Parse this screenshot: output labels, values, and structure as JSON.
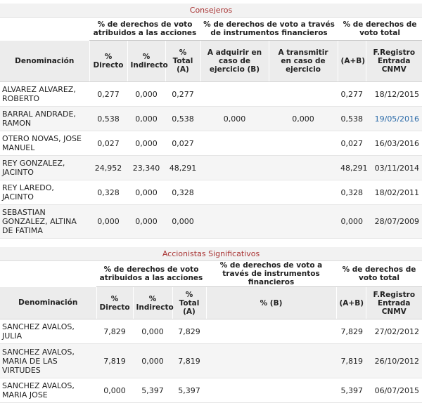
{
  "consejeros": {
    "title": "Consejeros",
    "group_headers": {
      "acciones": "% de derechos de voto atribuidos a las acciones",
      "instrumentos": "% de derechos de voto a través de instrumentos financieros",
      "total": "% de derechos de voto total"
    },
    "columns": {
      "denominacion": "Denominación",
      "directo": "% Directo",
      "indirecto": "% Indirecto",
      "total_a": "% Total (A)",
      "adquirir": "A adquirir en caso de ejercicio (B)",
      "transmitir": "A transmitir en caso de ejercicio",
      "ab": "(A+B)",
      "fregistro": "F.Registro Entrada CNMV"
    },
    "rows": [
      {
        "name": "ALVAREZ ALVAREZ, ROBERTO",
        "directo": "0,277",
        "indirecto": "0,000",
        "total_a": "0,277",
        "adquirir": "",
        "transmitir": "",
        "ab": "0,277",
        "fecha": "18/12/2015"
      },
      {
        "name": "BARRAL ANDRADE, RAMON",
        "directo": "0,538",
        "indirecto": "0,000",
        "total_a": "0,538",
        "adquirir": "0,000",
        "transmitir": "0,000",
        "ab": "0,538",
        "fecha": "19/05/2016"
      },
      {
        "name": "OTERO NOVAS, JOSE MANUEL",
        "directo": "0,027",
        "indirecto": "0,000",
        "total_a": "0,027",
        "adquirir": "",
        "transmitir": "",
        "ab": "0,027",
        "fecha": "16/03/2016"
      },
      {
        "name": "REY GONZALEZ, JACINTO",
        "directo": "24,952",
        "indirecto": "23,340",
        "total_a": "48,291",
        "adquirir": "",
        "transmitir": "",
        "ab": "48,291",
        "fecha": "03/11/2014"
      },
      {
        "name": "REY LAREDO, JACINTO",
        "directo": "0,328",
        "indirecto": "0,000",
        "total_a": "0,328",
        "adquirir": "",
        "transmitir": "",
        "ab": "0,328",
        "fecha": "18/02/2011"
      },
      {
        "name": "SEBASTIAN GONZALEZ, ALTINA DE FATIMA",
        "directo": "0,000",
        "indirecto": "0,000",
        "total_a": "0,000",
        "adquirir": "",
        "transmitir": "",
        "ab": "0,000",
        "fecha": "28/07/2009"
      }
    ]
  },
  "accionistas": {
    "title": "Accionistas Significativos",
    "group_headers": {
      "acciones": "% de derechos de voto atribuidos a las acciones",
      "instrumentos": "% de derechos de voto a través de instrumentos financieros",
      "total": "% de derechos de voto total"
    },
    "columns": {
      "denominacion": "Denominación",
      "directo": "% Directo",
      "indirecto": "% Indirecto",
      "total_a": "% Total (A)",
      "b": "% (B)",
      "ab": "(A+B)",
      "fregistro": "F.Registro Entrada CNMV"
    },
    "rows": [
      {
        "name": "SANCHEZ AVALOS, JULIA",
        "directo": "7,829",
        "indirecto": "0,000",
        "total_a": "7,829",
        "b": "",
        "ab": "7,829",
        "fecha": "27/02/2012"
      },
      {
        "name": "SANCHEZ AVALOS, MARIA DE LAS VIRTUDES",
        "directo": "7,819",
        "indirecto": "0,000",
        "total_a": "7,819",
        "b": "",
        "ab": "7,819",
        "fecha": "26/10/2012"
      },
      {
        "name": "SANCHEZ AVALOS, MARIA JOSE",
        "directo": "0,000",
        "indirecto": "5,397",
        "total_a": "5,397",
        "b": "",
        "ab": "5,397",
        "fecha": "06/07/2015"
      }
    ]
  },
  "colors": {
    "title_text": "#a83232",
    "header_bg": "#ececec",
    "alt_row_bg": "#f5f5f5",
    "link": "#2a6aa8"
  }
}
